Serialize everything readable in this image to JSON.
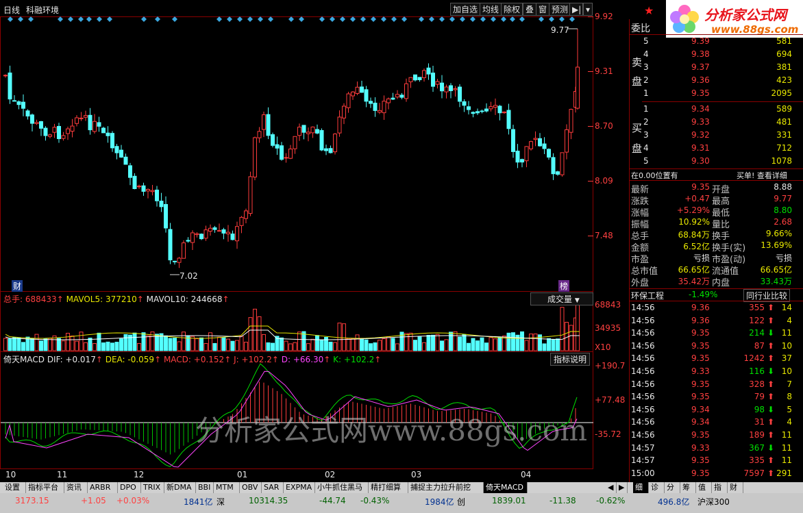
{
  "header": {
    "period": "日线",
    "indicator_env": "科融环境",
    "toolbar": [
      "加自选",
      "均线",
      "除权",
      "叠",
      "窗",
      "预测"
    ]
  },
  "main_chart": {
    "price_axis": [
      "9.92",
      "9.31",
      "8.70",
      "8.09",
      "7.48"
    ],
    "high_marker": "9.77",
    "low_marker": "7.02",
    "cai_badge": "财",
    "bang_badge": "榜"
  },
  "volume_panel": {
    "title": "总手",
    "value": "688433",
    "mavol5_label": "MAVOL5",
    "mavol5": "377210",
    "mavol10_label": "MAVOL10",
    "mavol10": "244668",
    "selector": "成交量",
    "axis": [
      "68843",
      "34935"
    ],
    "unit": "X10"
  },
  "macd_panel": {
    "title": "倚天MACD",
    "dif": "DIF: +0.017",
    "dea": "DEA: -0.059",
    "macd": "MACD: +0.152",
    "j": "J: +102.2",
    "d": "D: +66.30",
    "k": "K: +102.2",
    "help": "指标说明",
    "axis": [
      "+190.7",
      "+77.48",
      "-35.72"
    ]
  },
  "date_axis": [
    "10",
    "11",
    "12",
    "01",
    "02",
    "03",
    "04"
  ],
  "watermark": "分析家公式网www.88gs.com",
  "logo": {
    "title": "分析家公式网",
    "url": "www.88gs.com"
  },
  "order_book": {
    "title": "委比",
    "sell_label": [
      "卖",
      "盘"
    ],
    "buy_label": [
      "买",
      "盘"
    ],
    "sells": [
      {
        "lvl": "5",
        "price": "9.39",
        "vol": "581"
      },
      {
        "lvl": "4",
        "price": "9.38",
        "vol": "694"
      },
      {
        "lvl": "3",
        "price": "9.37",
        "vol": "381"
      },
      {
        "lvl": "2",
        "price": "9.36",
        "vol": "423"
      },
      {
        "lvl": "1",
        "price": "9.35",
        "vol": "2095"
      }
    ],
    "buys": [
      {
        "lvl": "1",
        "price": "9.34",
        "vol": "589"
      },
      {
        "lvl": "2",
        "price": "9.33",
        "vol": "481"
      },
      {
        "lvl": "3",
        "price": "9.32",
        "vol": "331"
      },
      {
        "lvl": "4",
        "price": "9.31",
        "vol": "712"
      },
      {
        "lvl": "5",
        "price": "9.30",
        "vol": "1078"
      }
    ],
    "pos_text": "在0.00位置有",
    "detail_link": "买单! 查看详细"
  },
  "quote": [
    {
      "l1": "最新",
      "v1": "9.35",
      "c1": "red",
      "l2": "开盘",
      "v2": "8.88",
      "c2": "white"
    },
    {
      "l1": "涨跌",
      "v1": "+0.47",
      "c1": "red",
      "l2": "最高",
      "v2": "9.77",
      "c2": "red"
    },
    {
      "l1": "涨幅",
      "v1": "+5.29%",
      "c1": "red",
      "l2": "最低",
      "v2": "8.80",
      "c2": "green"
    },
    {
      "l1": "振幅",
      "v1": "10.92%",
      "c1": "yellow",
      "l2": "量比",
      "v2": "2.68",
      "c2": "red"
    },
    {
      "l1": "总手",
      "v1": "68.84万",
      "c1": "yellow",
      "l2": "换手",
      "v2": "9.66%",
      "c2": "yellow"
    },
    {
      "l1": "金额",
      "v1": "6.52亿",
      "c1": "yellow",
      "l2": "换手(实)",
      "v2": "13.69%",
      "c2": "yellow"
    },
    {
      "l1": "市盈",
      "v1": "亏损",
      "c1": "white",
      "l2": "市盈(动)",
      "v2": "亏损",
      "c2": "white"
    },
    {
      "l1": "总市值",
      "v1": "66.65亿",
      "c1": "yellow",
      "l2": "流通值",
      "v2": "66.65亿",
      "c2": "yellow"
    },
    {
      "l1": "外盘",
      "v1": "35.42万",
      "c1": "red",
      "l2": "内盘",
      "v2": "33.43万",
      "c2": "green"
    }
  ],
  "sector": {
    "name": "环保工程",
    "change": "-1.49%",
    "compare": "同行业比较"
  },
  "ticks": [
    {
      "t": "14:56",
      "p": "9.36",
      "v": "355",
      "d": "up",
      "n": "14"
    },
    {
      "t": "14:56",
      "p": "9.36",
      "v": "122",
      "d": "up",
      "n": "4"
    },
    {
      "t": "14:56",
      "p": "9.35",
      "v": "214",
      "d": "down",
      "n": "11"
    },
    {
      "t": "14:56",
      "p": "9.35",
      "v": "87",
      "d": "up",
      "n": "10"
    },
    {
      "t": "14:56",
      "p": "9.35",
      "v": "1242",
      "d": "up",
      "n": "37"
    },
    {
      "t": "14:56",
      "p": "9.33",
      "v": "116",
      "d": "down",
      "n": "10"
    },
    {
      "t": "14:56",
      "p": "9.35",
      "v": "328",
      "d": "up",
      "n": "7"
    },
    {
      "t": "14:56",
      "p": "9.35",
      "v": "79",
      "d": "up",
      "n": "8"
    },
    {
      "t": "14:56",
      "p": "9.34",
      "v": "98",
      "d": "down",
      "n": "5"
    },
    {
      "t": "14:56",
      "p": "9.34",
      "v": "31",
      "d": "up",
      "n": "4"
    },
    {
      "t": "14:56",
      "p": "9.35",
      "v": "189",
      "d": "up",
      "n": "11"
    },
    {
      "t": "14:57",
      "p": "9.33",
      "v": "367",
      "d": "down",
      "n": "11"
    },
    {
      "t": "14:57",
      "p": "9.35",
      "v": "335",
      "d": "up",
      "n": "11"
    },
    {
      "t": "15:00",
      "p": "9.35",
      "v": "7597",
      "d": "up",
      "n": "291"
    }
  ],
  "tabs": [
    "设置",
    "指标平台",
    "资讯",
    "ARBR",
    "DPO",
    "TRIX",
    "新DMA",
    "BBI",
    "MTM",
    "OBV",
    "SAR",
    "EXPMA",
    "小牛抓住黑马",
    "精打细算",
    "捕捉主力拉升前挖",
    "倚天MACD"
  ],
  "right_tabs": [
    "细",
    "诊",
    "分",
    "筹",
    "值",
    "指",
    "财"
  ],
  "status": {
    "sh_index": "3173.15",
    "sh_change": "+1.05",
    "sh_pct": "+0.03%",
    "sh_amount": "1841亿",
    "sz_label": "深",
    "sz_index": "10314.35",
    "sz_change": "-44.74",
    "sz_pct": "-0.43%",
    "sz_amount": "1984亿",
    "cy_label": "创",
    "cy_index": "1839.01",
    "cy_change": "-11.38",
    "cy_pct": "-0.62%",
    "hs_amount": "496.8亿",
    "hs_label": "沪深300"
  },
  "colors": {
    "up": "#ff3c3c",
    "down": "#54ffff",
    "panel_border": "#8b0000",
    "grid": "#8b0000"
  }
}
